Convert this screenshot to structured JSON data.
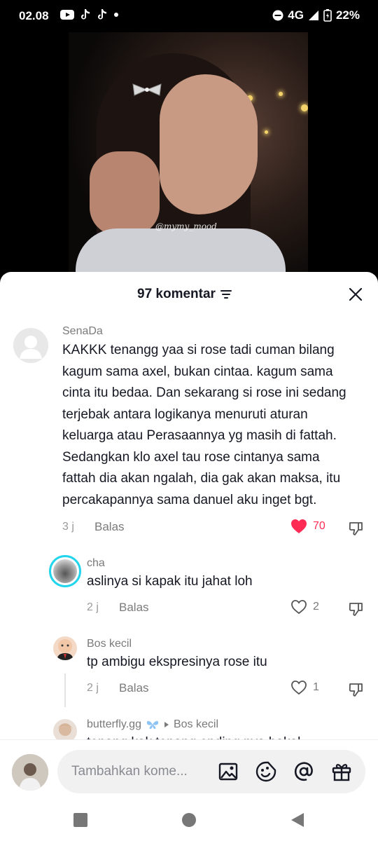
{
  "status_bar": {
    "time": "02.08",
    "network": "4G",
    "battery": "22%",
    "icons": [
      "youtube-icon",
      "tiktok-icon",
      "tiktok-icon",
      "dot-icon",
      "do-not-disturb-icon",
      "signal-icon",
      "battery-icon"
    ]
  },
  "video": {
    "watermark": "@mymy_mood"
  },
  "sheet": {
    "title": "97 komentar",
    "sort_icon": "sort-icon",
    "close_icon": "close-icon"
  },
  "comments": [
    {
      "username": "SenaDa",
      "text": "KAKKK tenangg yaa si rose tadi cuman bilang kagum sama axel, bukan cintaa. kagum sama cinta itu bedaa. Dan sekarang si rose ini sedang terjebak antara logikanya menuruti aturan keluarga atau Perasaannya yg masih di fattah. Sedangkan klo axel tau rose cintanya sama fattah dia akan ngalah, dia gak akan maksa, itu percakapannya sama danuel aku inget bgt.",
      "time": "3 j",
      "reply_label": "Balas",
      "likes": "70",
      "liked": true
    }
  ],
  "replies": [
    {
      "username": "cha",
      "text": "aslinya si kapak itu jahat loh",
      "time": "2 j",
      "reply_label": "Balas",
      "likes": "2",
      "liked": false
    },
    {
      "username": "Bos kecil",
      "text": "tp ambigu ekspresinya rose itu",
      "time": "2 j",
      "reply_label": "Balas",
      "likes": "1",
      "liked": false
    },
    {
      "username": "butterfly.gg",
      "reply_to": "Bos kecil",
      "text": "tenang kak tenang ending nya bakal"
    }
  ],
  "composer": {
    "placeholder": "Tambahkan kome...",
    "tools": [
      "image-icon",
      "emoji-icon",
      "mention-icon",
      "gift-icon"
    ]
  },
  "navbar": {
    "buttons": [
      "recents-button",
      "home-button",
      "back-button"
    ]
  },
  "colors": {
    "accent": "#fe2c55",
    "text": "#161823",
    "muted": "#7a7a7a"
  }
}
